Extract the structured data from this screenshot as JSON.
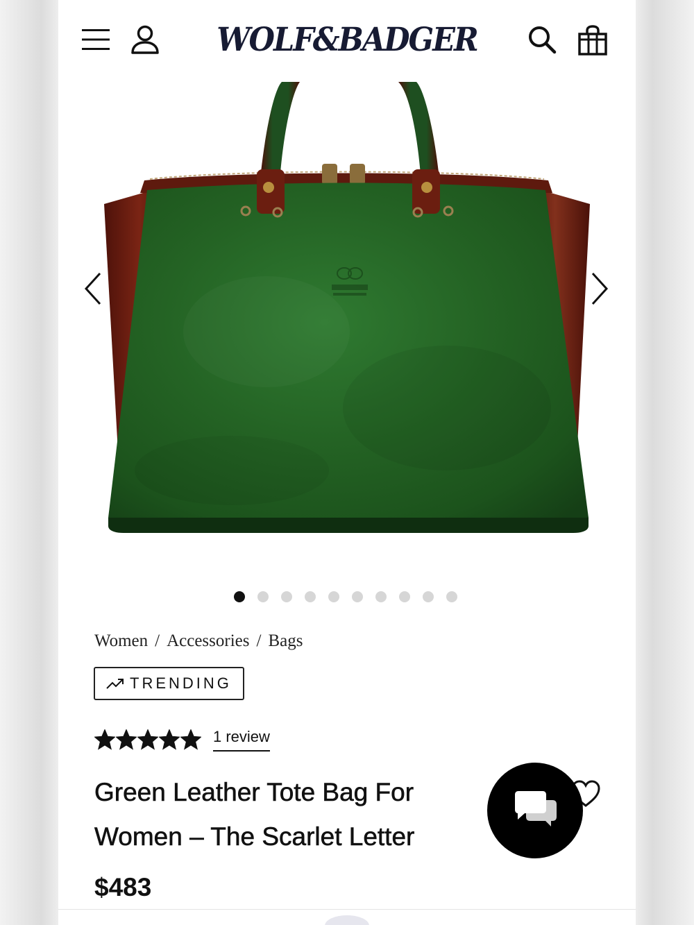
{
  "header": {
    "brand": "WOLF&BADGER",
    "menu_icon": "hamburger-menu-icon",
    "account_icon": "user-icon",
    "search_icon": "search-icon",
    "bag_icon": "shopping-bag-icon"
  },
  "gallery": {
    "image_count": 10,
    "active_index": 0,
    "prev_icon": "chevron-left-icon",
    "next_icon": "chevron-right-icon"
  },
  "breadcrumb": {
    "items": [
      "Women",
      "Accessories",
      "Bags"
    ],
    "separator": "/"
  },
  "badge": {
    "label": "TRENDING",
    "icon": "trending-up-icon"
  },
  "rating": {
    "stars": 5,
    "max_stars": 5,
    "review_text": "1 review"
  },
  "product": {
    "title_line1": "Green Leather Tote Bag For",
    "title_line2": "Women – The Scarlet Letter",
    "price": "$483",
    "wishlist_icon": "heart-icon",
    "chat_icon": "chat-bubbles-icon"
  },
  "colors": {
    "brand_navy": "#171b33",
    "bag_green": "#2a6a2c",
    "bag_brown": "#6e1f12",
    "text": "#111111",
    "dot_inactive": "#d6d6d6"
  }
}
